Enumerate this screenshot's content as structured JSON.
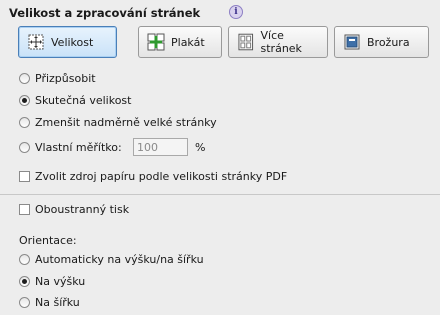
{
  "section": {
    "title": "Velikost a zpracování stránek",
    "info_icon": "info-icon"
  },
  "modes": [
    {
      "label": "Velikost",
      "icon": "page-size-icon",
      "active": true
    },
    {
      "label": "Plakát",
      "icon": "poster-icon",
      "active": false
    },
    {
      "label": "Více stránek",
      "icon": "multiple-pages-icon",
      "active": false
    },
    {
      "label": "Brožura",
      "icon": "booklet-icon",
      "active": false
    }
  ],
  "size_options": [
    {
      "label": "Přizpůsobit",
      "selected": false
    },
    {
      "label": "Skutečná velikost",
      "selected": true
    },
    {
      "label": "Zmenšit nadměrně velké stránky",
      "selected": false
    },
    {
      "label": "Vlastní měřítko:",
      "selected": false
    }
  ],
  "custom_scale": {
    "value": "100",
    "unit": "%"
  },
  "paper_source": {
    "label": "Zvolit zdroj papíru podle velikosti stránky PDF",
    "checked": false
  },
  "duplex": {
    "label": "Oboustranný tisk",
    "checked": false
  },
  "orientation": {
    "label": "Orientace:",
    "options": [
      {
        "label": "Automaticky na výšku/na šířku",
        "selected": false
      },
      {
        "label": "Na výšku",
        "selected": true
      },
      {
        "label": "Na šířku",
        "selected": false
      }
    ]
  },
  "colors": {
    "active_border": "#4a7fb8",
    "active_fill": "#c9e2f8"
  }
}
